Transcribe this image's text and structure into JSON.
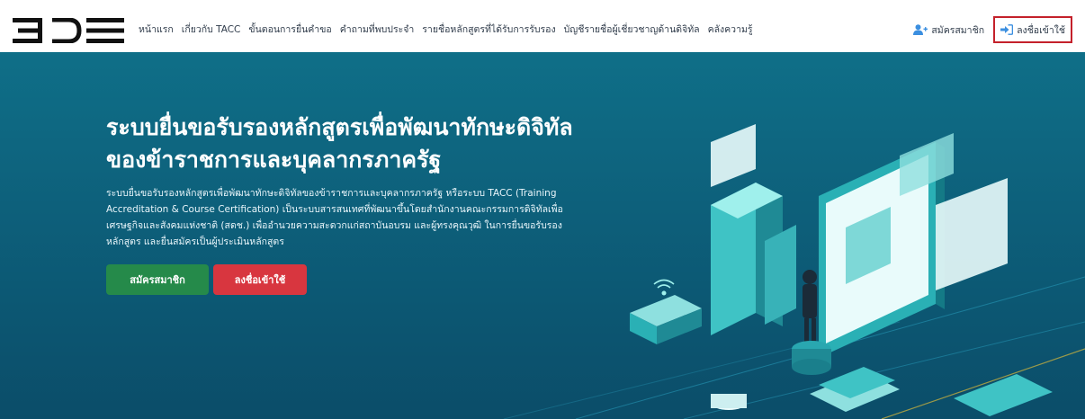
{
  "header": {
    "logo_text": "BDE",
    "menu": [
      "หน้าแรก",
      "เกี่ยวกับ TACC",
      "ขั้นตอนการยื่นคำขอ",
      "คำถามที่พบประจำ",
      "รายชื่อหลักสูตรที่ได้รับการรับรอง",
      "บัญชีรายชื่อผู้เชี่ยวชาญด้านดิจิทัล",
      "คลังความรู้"
    ],
    "register_label": "สมัครสมาชิก",
    "login_label": "ลงชื่อเข้าใช้"
  },
  "hero": {
    "title_line1": "ระบบยื่นขอรับรองหลักสูตรเพื่อพัฒนาทักษะดิจิทัล",
    "title_line2": "ของข้าราชการและบุคลากรภาครัฐ",
    "description": "ระบบยื่นขอรับรองหลักสูตรเพื่อพัฒนาทักษะดิจิทัลของข้าราชการและบุคลากรภาครัฐ หรือระบบ TACC (Training Accreditation & Course Certification) เป็นระบบสารสนเทศที่พัฒนาขึ้นโดยสำนักงานคณะกรรมการดิจิทัลเพื่อเศรษฐกิจและสังคมแห่งชาติ (สดช.) เพื่ออำนวยความสะดวกแก่สถาบันอบรม และผู้ทรงคุณวุฒิ ในการยื่นขอรับรองหลักสูตร และยื่นสมัครเป็นผู้ประเมินหลักสูตร",
    "register_button": "สมัครสมาชิก",
    "login_button": "ลงชื่อเข้าใช้"
  },
  "colors": {
    "hero_bg": "#0d5f7a",
    "register_btn": "#258a4a",
    "login_btn": "#d8363f",
    "highlight_border": "#c4212b",
    "register_icon": "#3b8fe0"
  }
}
